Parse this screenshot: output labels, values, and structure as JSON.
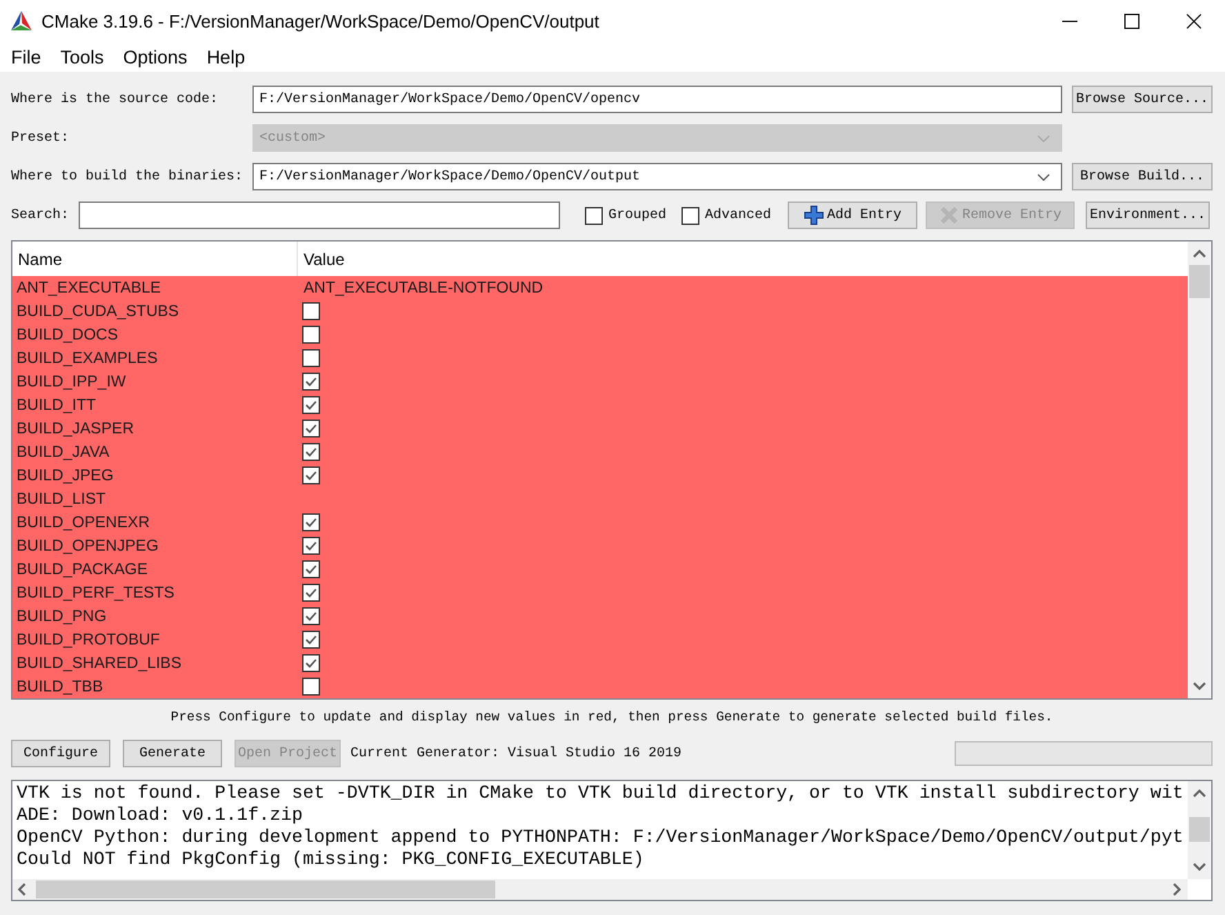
{
  "window": {
    "title": "CMake 3.19.6 - F:/VersionManager/WorkSpace/Demo/OpenCV/output"
  },
  "menu": [
    "File",
    "Tools",
    "Options",
    "Help"
  ],
  "paths": [
    {
      "label": "Where is the source code:",
      "kind": "field",
      "value": "F:/VersionManager/WorkSpace/Demo/OpenCV/opencv",
      "disabled": false,
      "button": "Browse Source..."
    },
    {
      "label": "Preset:",
      "kind": "combo",
      "value": "<custom>",
      "disabled": true
    },
    {
      "label": "Where to build the binaries:",
      "kind": "combo",
      "value": "F:/VersionManager/WorkSpace/Demo/OpenCV/output",
      "disabled": false,
      "button": "Browse Build..."
    }
  ],
  "search": {
    "label": "Search:"
  },
  "options": [
    {
      "label": "Grouped",
      "checked": false
    },
    {
      "label": "Advanced",
      "checked": false
    }
  ],
  "entry_buttons": [
    {
      "label": "Add Entry",
      "kind": "add",
      "disabled": false
    },
    {
      "label": "Remove Entry",
      "kind": "remove",
      "disabled": true
    },
    {
      "label": "Environment...",
      "kind": "plain",
      "disabled": false
    }
  ],
  "table": {
    "columns": [
      "Name",
      "Value"
    ],
    "rows": [
      {
        "name": "ANT_EXECUTABLE",
        "kind": "text",
        "value": "ANT_EXECUTABLE-NOTFOUND",
        "new": true
      },
      {
        "name": "BUILD_CUDA_STUBS",
        "kind": "bool",
        "checked": false,
        "new": true
      },
      {
        "name": "BUILD_DOCS",
        "kind": "bool",
        "checked": false,
        "new": true
      },
      {
        "name": "BUILD_EXAMPLES",
        "kind": "bool",
        "checked": false,
        "new": true
      },
      {
        "name": "BUILD_IPP_IW",
        "kind": "bool",
        "checked": true,
        "new": true
      },
      {
        "name": "BUILD_ITT",
        "kind": "bool",
        "checked": true,
        "new": true
      },
      {
        "name": "BUILD_JASPER",
        "kind": "bool",
        "checked": true,
        "new": true
      },
      {
        "name": "BUILD_JAVA",
        "kind": "bool",
        "checked": true,
        "new": true
      },
      {
        "name": "BUILD_JPEG",
        "kind": "bool",
        "checked": true,
        "new": true
      },
      {
        "name": "BUILD_LIST",
        "kind": "text",
        "new": true
      },
      {
        "name": "BUILD_OPENEXR",
        "kind": "bool",
        "checked": true,
        "new": true
      },
      {
        "name": "BUILD_OPENJPEG",
        "kind": "bool",
        "checked": true,
        "new": true
      },
      {
        "name": "BUILD_PACKAGE",
        "kind": "bool",
        "checked": true,
        "new": true
      },
      {
        "name": "BUILD_PERF_TESTS",
        "kind": "bool",
        "checked": true,
        "new": true
      },
      {
        "name": "BUILD_PNG",
        "kind": "bool",
        "checked": true,
        "new": true
      },
      {
        "name": "BUILD_PROTOBUF",
        "kind": "bool",
        "checked": true,
        "new": true
      },
      {
        "name": "BUILD_SHARED_LIBS",
        "kind": "bool",
        "checked": true,
        "new": true
      },
      {
        "name": "BUILD_TBB",
        "kind": "bool",
        "checked": false,
        "new": true
      }
    ]
  },
  "hint": "Press Configure to update and display new values in red, then press Generate to generate selected build files.",
  "actions": [
    {
      "label": "Configure",
      "disabled": false
    },
    {
      "label": "Generate",
      "disabled": false
    },
    {
      "label": "Open Project",
      "disabled": true
    }
  ],
  "generator": "Current Generator: Visual Studio 16 2019",
  "progress": {
    "level": 0
  },
  "log": [
    "VTK is not found. Please set -DVTK_DIR in CMake to VTK build directory, or to VTK install subdirectory wit",
    "ADE: Download: v0.1.1f.zip",
    "OpenCV Python: during development append to PYTHONPATH: F:/VersionManager/WorkSpace/Demo/OpenCV/output/pyt",
    "Could NOT find PkgConfig (missing: PKG_CONFIG_EXECUTABLE)"
  ]
}
